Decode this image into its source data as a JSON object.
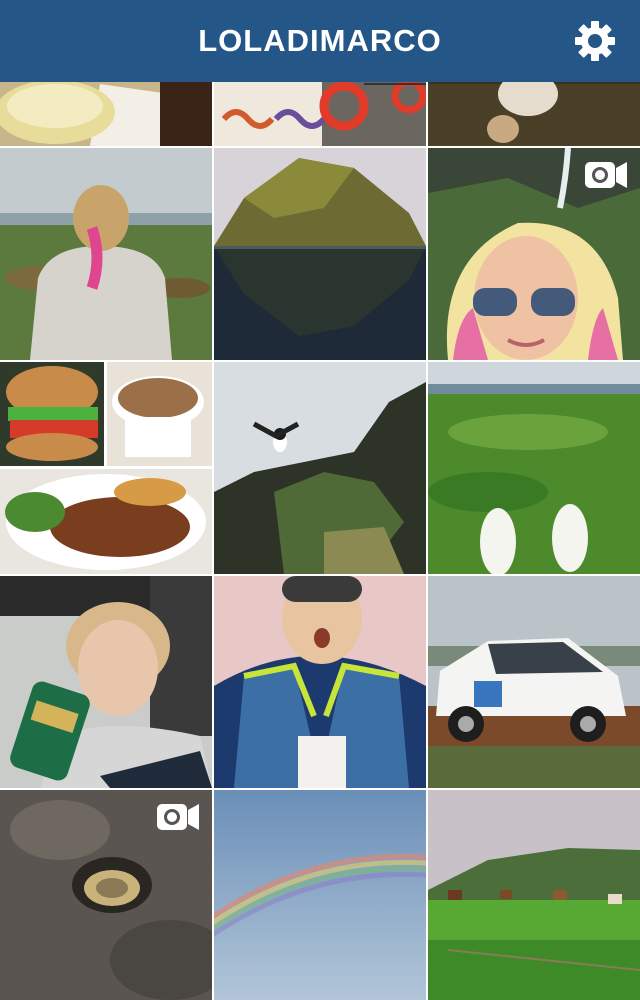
{
  "header": {
    "username": "LOLADIMARCO",
    "settings_icon": "gear-icon",
    "background": "#245688"
  },
  "grid": {
    "video_icon": "video-camera-icon",
    "posts": [
      {
        "name": "post-lemon-drink",
        "video": false
      },
      {
        "name": "post-rope-knots-lifebuoy",
        "video": false
      },
      {
        "name": "post-dog-on-grass",
        "video": false
      },
      {
        "name": "post-pink-braid-woman",
        "video": false
      },
      {
        "name": "post-rock-mountain-lake",
        "video": false
      },
      {
        "name": "post-selfie-waterfall",
        "video": true
      },
      {
        "name": "post-food-collage",
        "video": false
      },
      {
        "name": "post-puffin-cliff",
        "video": false
      },
      {
        "name": "post-sneakers-field",
        "video": false
      },
      {
        "name": "post-woman-drinking-can",
        "video": false
      },
      {
        "name": "post-surprised-woman-lifejacket",
        "video": false
      },
      {
        "name": "post-white-suv",
        "video": false
      },
      {
        "name": "post-sand-hole",
        "video": true
      },
      {
        "name": "post-rainbow-sky",
        "video": false
      },
      {
        "name": "post-horses-valley",
        "video": false
      }
    ]
  }
}
